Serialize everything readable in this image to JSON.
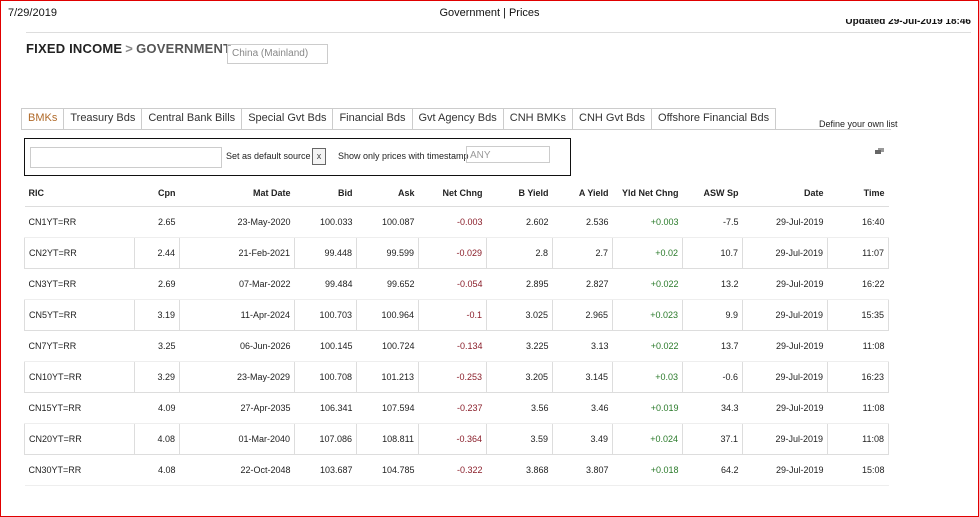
{
  "print_header": {
    "date": "7/29/2019",
    "title": "Government | Prices",
    "updated": "Updated 29-Jul-2019 18:46"
  },
  "breadcrumb": {
    "section": "FIXED INCOME",
    "separator": ">",
    "page": "GOVERNMENT"
  },
  "region_select": {
    "value": "China (Mainland)"
  },
  "tabs": [
    "BMKs",
    "Treasury Bds",
    "Central Bank Bills",
    "Special Gvt Bds",
    "Financial Bds",
    "Gvt Agency Bds",
    "CNH BMKs",
    "CNH Gvt Bds",
    "Offshore Financial Bds"
  ],
  "define_list": "Define your own list",
  "filter": {
    "ric_value": "",
    "default_label": "Set as default source",
    "clear_symbol": "x",
    "timestamp_label": "Show only prices with timestamp",
    "timestamp_value": "ANY"
  },
  "table": {
    "columns": [
      "RIC",
      "Cpn",
      "Mat Date",
      "Bid",
      "Ask",
      "Net Chng",
      "B Yield",
      "A Yield",
      "Yld Net Chng",
      "ASW Sp",
      "Date",
      "Time"
    ],
    "rows": [
      [
        "CN1YT=RR",
        "2.65",
        "23-May-2020",
        "100.033",
        "100.087",
        "-0.003",
        "2.602",
        "2.536",
        "+0.003",
        "-7.5",
        "29-Jul-2019",
        "16:40"
      ],
      [
        "CN2YT=RR",
        "2.44",
        "21-Feb-2021",
        "99.448",
        "99.599",
        "-0.029",
        "2.8",
        "2.7",
        "+0.02",
        "10.7",
        "29-Jul-2019",
        "11:07"
      ],
      [
        "CN3YT=RR",
        "2.69",
        "07-Mar-2022",
        "99.484",
        "99.652",
        "-0.054",
        "2.895",
        "2.827",
        "+0.022",
        "13.2",
        "29-Jul-2019",
        "16:22"
      ],
      [
        "CN5YT=RR",
        "3.19",
        "11-Apr-2024",
        "100.703",
        "100.964",
        "-0.1",
        "3.025",
        "2.965",
        "+0.023",
        "9.9",
        "29-Jul-2019",
        "15:35"
      ],
      [
        "CN7YT=RR",
        "3.25",
        "06-Jun-2026",
        "100.145",
        "100.724",
        "-0.134",
        "3.225",
        "3.13",
        "+0.022",
        "13.7",
        "29-Jul-2019",
        "11:08"
      ],
      [
        "CN10YT=RR",
        "3.29",
        "23-May-2029",
        "100.708",
        "101.213",
        "-0.253",
        "3.205",
        "3.145",
        "+0.03",
        "-0.6",
        "29-Jul-2019",
        "16:23"
      ],
      [
        "CN15YT=RR",
        "4.09",
        "27-Apr-2035",
        "106.341",
        "107.594",
        "-0.237",
        "3.56",
        "3.46",
        "+0.019",
        "34.3",
        "29-Jul-2019",
        "11:08"
      ],
      [
        "CN20YT=RR",
        "4.08",
        "01-Mar-2040",
        "107.086",
        "108.811",
        "-0.364",
        "3.59",
        "3.49",
        "+0.024",
        "37.1",
        "29-Jul-2019",
        "11:08"
      ],
      [
        "CN30YT=RR",
        "4.08",
        "22-Oct-2048",
        "103.687",
        "104.785",
        "-0.322",
        "3.868",
        "3.807",
        "+0.018",
        "64.2",
        "29-Jul-2019",
        "15:08"
      ]
    ]
  },
  "colors": {
    "accent_tab": "#b06a2a",
    "negative": "#8a1e2a",
    "positive": "#2a7a2a",
    "page_border": "#e00000"
  },
  "icons": {
    "popout": "popout-window-icon",
    "clear": "close-icon"
  }
}
